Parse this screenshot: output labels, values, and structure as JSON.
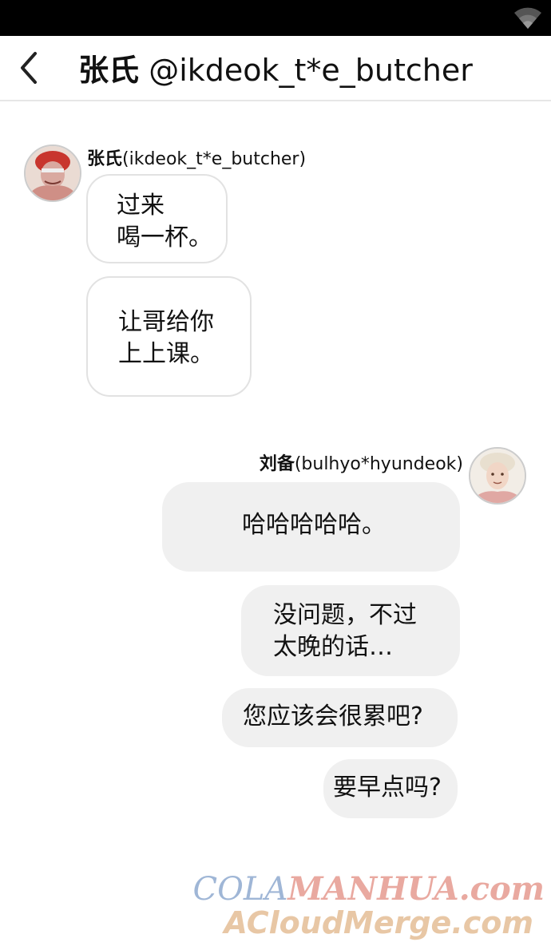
{
  "header": {
    "name": "张氏",
    "handle": "@ikdeok_t*e_butcher"
  },
  "messages_in": {
    "sender_name": "张氏",
    "sender_handle": "(ikdeok_t*e_butcher)",
    "bubbles": [
      "过来\n喝一杯。",
      "让哥给你\n上上课。"
    ]
  },
  "messages_out": {
    "sender_name": "刘备",
    "sender_handle": "(bulhyo*hyundeok)",
    "bubbles": [
      "哈哈哈哈哈。",
      "没问题，不过\n太晚的话…",
      "您应该会很累吧?",
      "要早点吗?"
    ]
  },
  "watermark": {
    "line1_a": "COLA",
    "line1_b": "MANHUA.com",
    "line2": "ACloudMerge.com"
  }
}
